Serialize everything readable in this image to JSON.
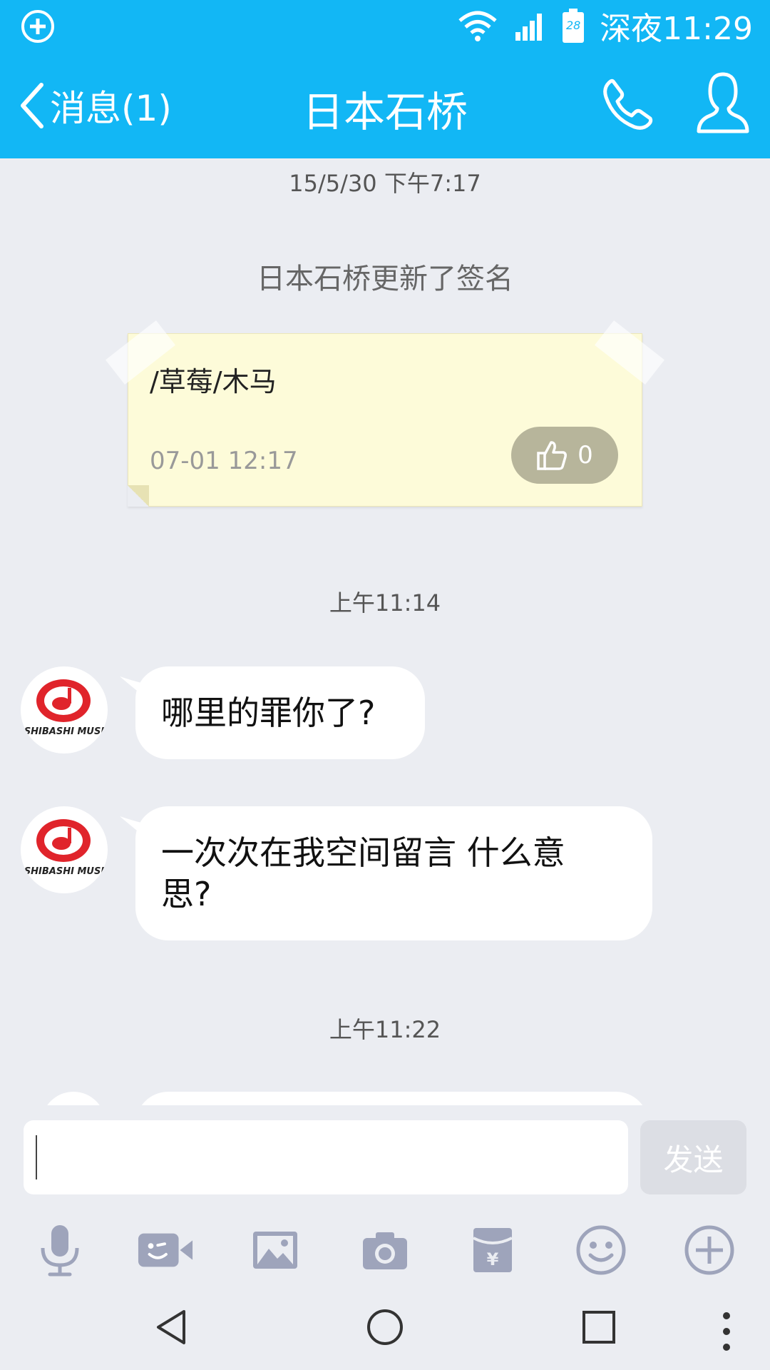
{
  "status_bar": {
    "time": "深夜11:29",
    "battery_level": "28",
    "icons": [
      "add-circle-icon",
      "wifi-icon",
      "signal-icon",
      "battery-icon"
    ]
  },
  "header": {
    "back_label": "消息(1)",
    "title": "日本石桥",
    "icons": [
      "chevron-left-icon",
      "phone-icon",
      "profile-icon"
    ]
  },
  "messages": {
    "timestamp_1": "15/5/30 下午7:17",
    "system_note": "日本石桥更新了签名",
    "signature": {
      "text": "/草莓/木马",
      "date": "07-01 12:17",
      "like_count": "0"
    },
    "timestamp_2": "上午11:14",
    "bubble_1": "哪里的罪你了?",
    "bubble_2": "一次次在我空间留言  什么意思?",
    "timestamp_3": "上午11:22"
  },
  "input": {
    "value": "",
    "send_label": "发送"
  },
  "toolbar": {
    "icons": [
      "microphone-icon",
      "video-call-icon",
      "image-icon",
      "camera-icon",
      "red-packet-icon",
      "emoji-icon",
      "plus-icon"
    ]
  },
  "nav": {
    "icons": [
      "back-triangle-icon",
      "home-circle-icon",
      "recents-square-icon",
      "menu-dots-icon"
    ]
  },
  "colors": {
    "accent": "#12b7f5",
    "background": "#ebedf2",
    "bubble": "#ffffff",
    "icon_gray": "#9ea4bb"
  }
}
